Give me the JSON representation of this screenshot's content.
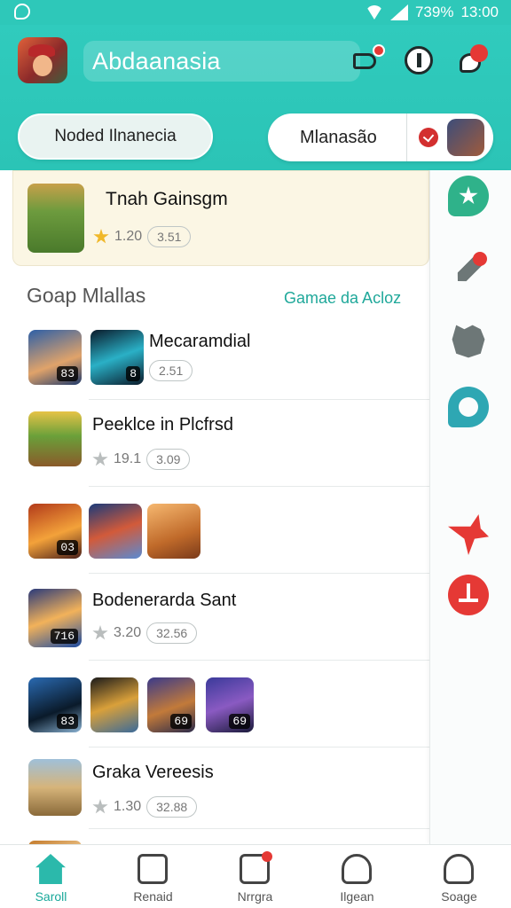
{
  "status_bar": {
    "battery": "739%",
    "time": "13:00"
  },
  "header": {
    "app_title": "Abdaanasia",
    "pill_left": "Noded Ilnanecia",
    "pill_right": "Mlanasão"
  },
  "featured": {
    "title": "Tnah Gainsgm",
    "rating": "1.20",
    "badge": "3.51"
  },
  "section": {
    "title": "Goap Mlallas",
    "link": "Gamae da Acloz"
  },
  "rows": [
    {
      "title": "Mecaramdial",
      "badge": "2.51",
      "thumb_nums": [
        "83",
        "8"
      ]
    },
    {
      "title": "Peeklce in Plcfrsd",
      "rating": "19.1",
      "badge": "3.09"
    },
    {
      "thumb_nums": [
        "03",
        "",
        ""
      ]
    },
    {
      "title": "Bodenerarda Sant",
      "rating": "3.20",
      "badge": "32.56",
      "thumb_num": "716"
    },
    {
      "thumb_nums": [
        "83",
        "",
        "69",
        "69"
      ]
    },
    {
      "title": "Graka Vereesis",
      "rating": "1.30",
      "badge": "32.88"
    }
  ],
  "bottom_nav": [
    {
      "label": "Saroll",
      "icon": "home-icon",
      "active": true
    },
    {
      "label": "Renaid",
      "icon": "frame-icon"
    },
    {
      "label": "Nrrgra",
      "icon": "edit-icon"
    },
    {
      "label": "Ilgean",
      "icon": "search-user-icon"
    },
    {
      "label": "Soage",
      "icon": "profile-icon"
    }
  ],
  "side_rail_icons": [
    "badge-icon",
    "pen-icon",
    "puzzle-icon",
    "chat-icon",
    "star-icon",
    "alert-icon"
  ],
  "colors": {
    "accent": "#2ec8b9",
    "accent_dark": "#19a89a",
    "alert": "#e53935",
    "featured_bg": "#fbf6e4"
  }
}
